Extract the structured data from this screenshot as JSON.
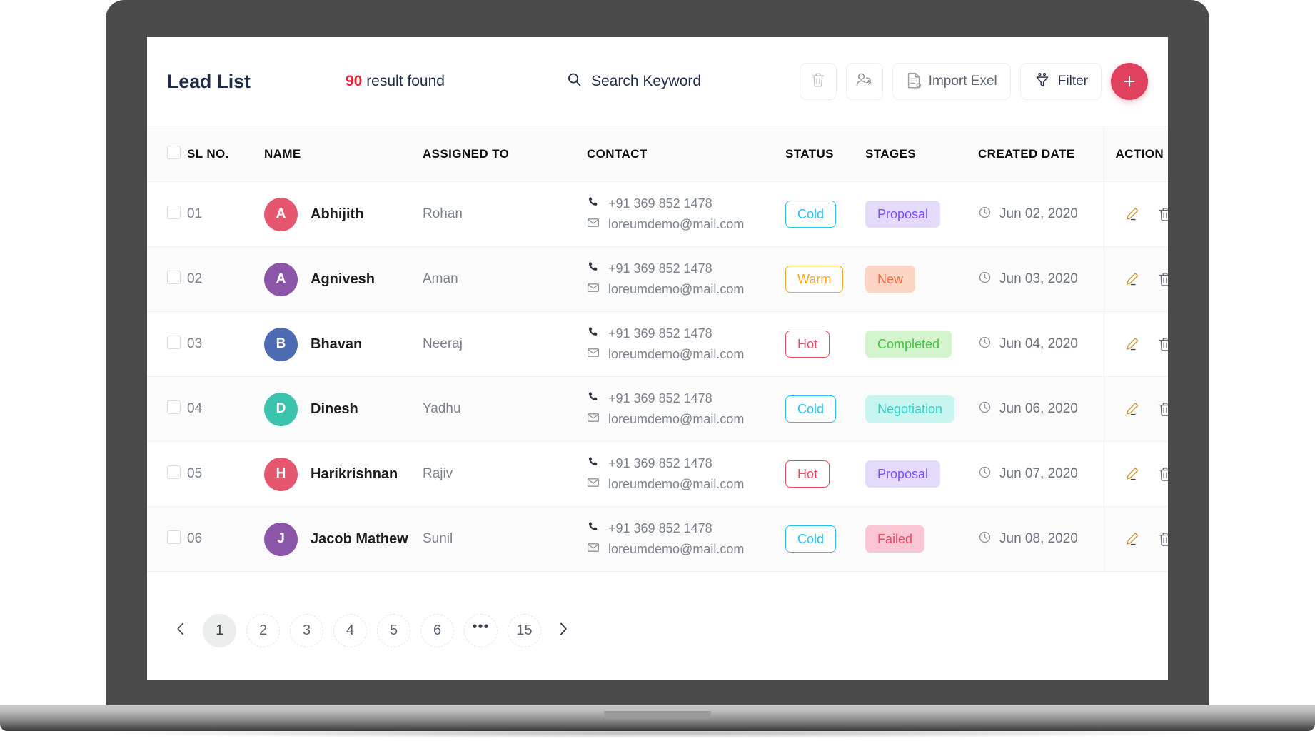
{
  "header": {
    "title": "Lead List",
    "result_count_number": "90",
    "result_count_suffix": " result found"
  },
  "search": {
    "placeholder": "Search Keyword",
    "value": "",
    "icon": "search-icon"
  },
  "toolbar": {
    "delete_icon": "trash-icon",
    "assign_icon": "user-transfer-icon",
    "import_label": "Import Exel",
    "import_icon": "document-icon",
    "filter_label": "Filter",
    "filter_icon": "funnel-icon",
    "add_label": "+",
    "add_icon": "plus-icon",
    "add_color": "#e0415e"
  },
  "table": {
    "columns": [
      "SL NO.",
      "NAME",
      "ASSIGNED TO",
      "CONTACT",
      "STATUS",
      "STAGES",
      "CREATED DATE",
      "ACTION"
    ],
    "rows": [
      {
        "sl": "01",
        "avatar_letter": "A",
        "avatar_color": "#e4576f",
        "name": "Abhijith",
        "assigned_to": "Rohan",
        "phone": "+91 369 852 1478",
        "email": "loreumdemo@mail.com",
        "status": "Cold",
        "status_color": "#22c3f3",
        "stage": "Proposal",
        "stage_color": "#7c4dff",
        "stage_bg": "#e4dbfb",
        "created_date": "Jun 02, 2020"
      },
      {
        "sl": "02",
        "avatar_letter": "A",
        "avatar_color": "#8b56a8",
        "name": "Agnivesh",
        "assigned_to": "Aman",
        "phone": "+91 369 852 1478",
        "email": "loreumdemo@mail.com",
        "status": "Warm",
        "status_color": "#f5a623",
        "stage": "New",
        "stage_color": "#fa6b3f",
        "stage_bg": "#fcd5c5",
        "created_date": "Jun 03, 2020"
      },
      {
        "sl": "03",
        "avatar_letter": "B",
        "avatar_color": "#4d6bb3",
        "name": "Bhavan",
        "assigned_to": "Neeraj",
        "phone": "+91 369 852 1478",
        "email": "loreumdemo@mail.com",
        "status": "Hot",
        "status_color": "#f5445e",
        "stage": "Completed",
        "stage_color": "#3fc63f",
        "stage_bg": "#d4f4cd",
        "created_date": "Jun 04, 2020"
      },
      {
        "sl": "04",
        "avatar_letter": "D",
        "avatar_color": "#3cc3ad",
        "name": "Dinesh",
        "assigned_to": "Yadhu",
        "phone": "+91 369 852 1478",
        "email": "loreumdemo@mail.com",
        "status": "Cold",
        "status_color": "#22c3f3",
        "stage": "Negotiation",
        "stage_color": "#2bd4c7",
        "stage_bg": "#c8f5f0",
        "created_date": "Jun 06, 2020"
      },
      {
        "sl": "05",
        "avatar_letter": "H",
        "avatar_color": "#e4576f",
        "name": "Harikrishnan",
        "assigned_to": "Rajiv",
        "phone": "+91 369 852 1478",
        "email": "loreumdemo@mail.com",
        "status": "Hot",
        "status_color": "#f5445e",
        "stage": "Proposal",
        "stage_color": "#7c4dff",
        "stage_bg": "#e4dbfb",
        "created_date": "Jun 07, 2020"
      },
      {
        "sl": "06",
        "avatar_letter": "J",
        "avatar_color": "#8b56a8",
        "name": "Jacob Mathew",
        "assigned_to": "Sunil",
        "phone": "+91 369 852 1478",
        "email": "loreumdemo@mail.com",
        "status": "Cold",
        "status_color": "#22c3f3",
        "stage": "Failed",
        "stage_color": "#f5445e",
        "stage_bg": "#fbc6d4",
        "created_date": "Jun 08, 2020"
      }
    ]
  },
  "pagination": {
    "prev_icon": "chevron-left-icon",
    "next_icon": "chevron-right-icon",
    "pages": [
      "1",
      "2",
      "3",
      "4",
      "5",
      "6",
      "•••",
      "15"
    ],
    "active_page": "1"
  }
}
